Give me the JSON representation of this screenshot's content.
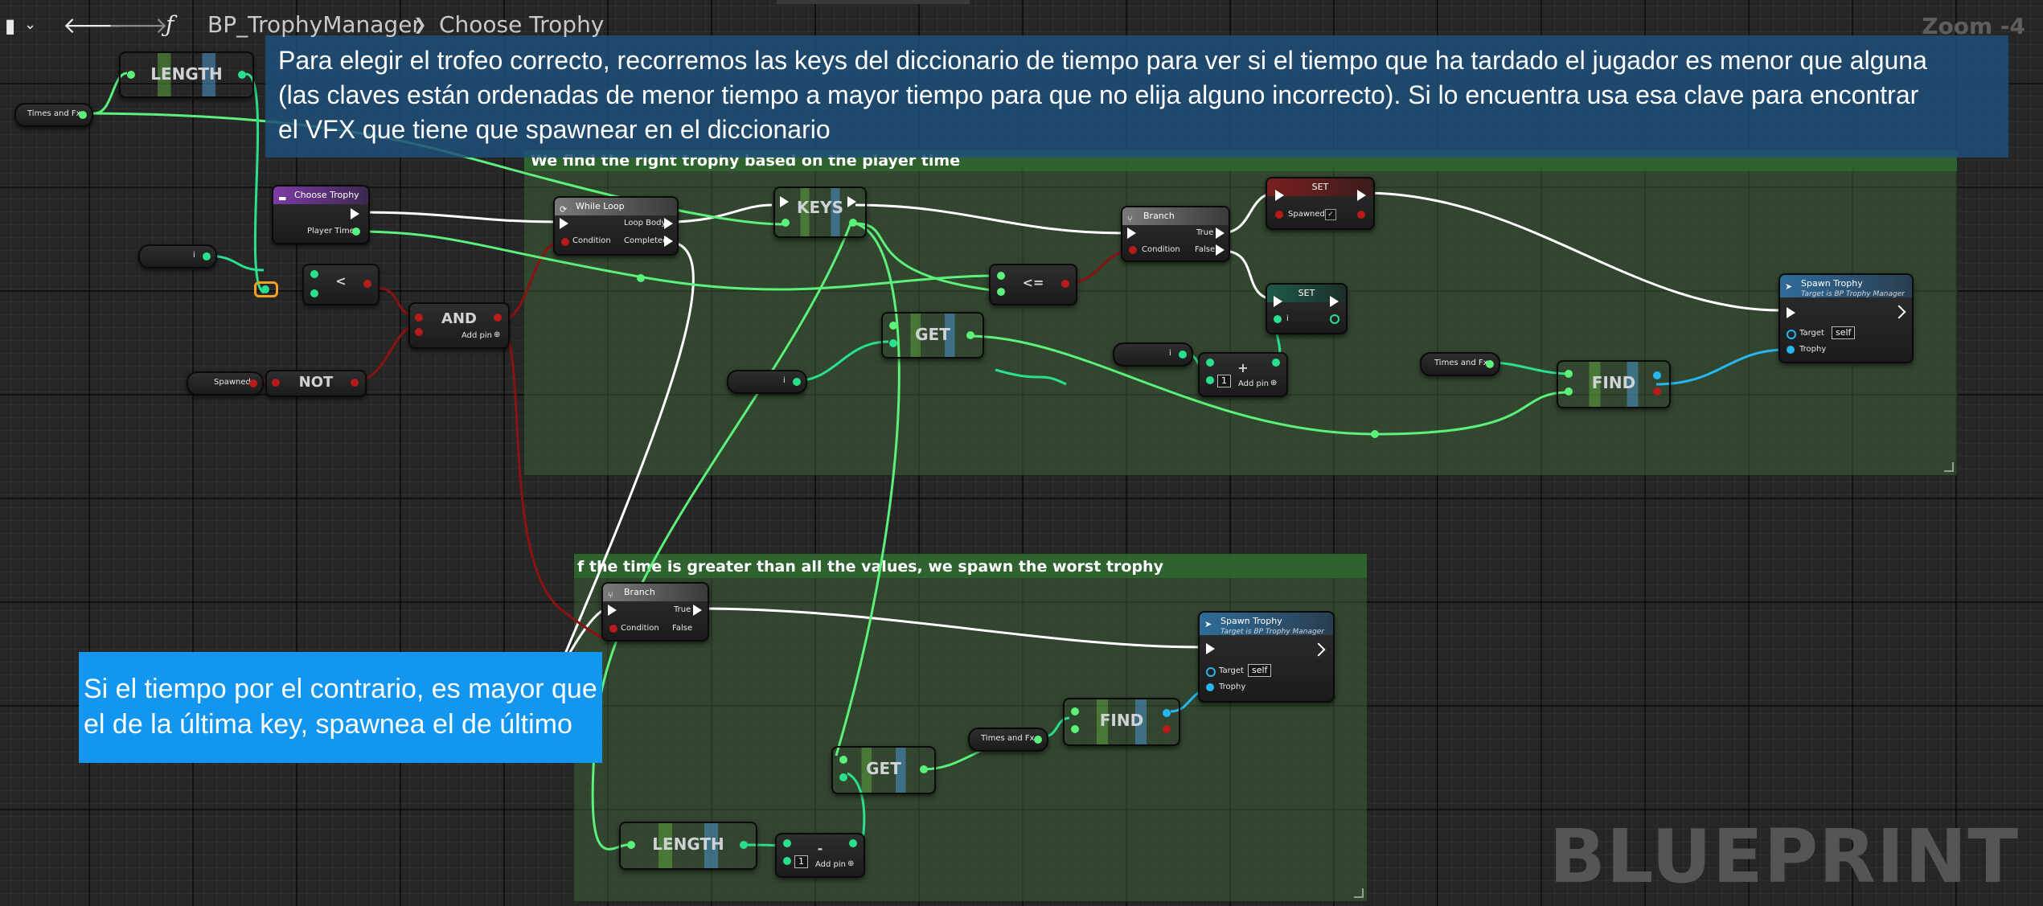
{
  "topbar": {
    "function_icon": "function-icon",
    "breadcrumb_parent": "BP_TrophyManager",
    "breadcrumb_separator": "❯",
    "breadcrumb_current": "Choose Trophy",
    "zoom": "Zoom -4"
  },
  "notes": {
    "top_lines": [
      "Para elegir el trofeo correcto, recorremos las keys del diccionario de tiempo para ver si el tiempo que ha tardado el jugador es menor que alguna",
      "(las claves están ordenadas de menor tiempo a mayor tiempo para que no elija alguno incorrecto). Si lo encuentra usa esa clave para encontrar",
      "el  VFX que tiene que spawnear en el diccionario"
    ],
    "bottom_lines": [
      "Si el tiempo por el contrario, es mayor que",
      "el de la última key, spawnea el de último"
    ]
  },
  "comments": {
    "top": "We find the right trophy based on the player time",
    "bottom": "f the time is greater than all the values, we spawn the worst trophy"
  },
  "nodes": {
    "length": "LENGTH",
    "times_and_fx": "Times and Fx",
    "choose_trophy": "Choose Trophy",
    "player_time": "Player Time",
    "i": "i",
    "less": "<",
    "less_equal": "<=",
    "and": "AND",
    "not": "NOT",
    "add_pin": "Add pin",
    "spawned": "Spawned",
    "while_loop": "While Loop",
    "loop_body": "Loop Body",
    "condition": "Condition",
    "completed": "Completed",
    "keys": "KEYS",
    "branch": "Branch",
    "true": "True",
    "false": "False",
    "set": "SET",
    "get": "GET",
    "find": "FIND",
    "plus": "+",
    "minus": "-",
    "one": "1",
    "spawn_trophy": "Spawn Trophy",
    "target_is": "Target is BP Trophy Manager",
    "target": "Target",
    "self": "self",
    "trophy": "Trophy"
  },
  "watermark": "BLUEPRINT",
  "colors": {
    "note_top_bg": "#1f4f7a",
    "note_bottom_bg": "#1296f0",
    "comment_bg": "#2f482a",
    "comment_title_bg": "#2b5a2d",
    "float_wire": "#5cf17a",
    "int_wire": "#2be08d",
    "bool_wire": "#8a1212",
    "exec_wire": "#ffffff",
    "object_wire": "#27b6f0"
  }
}
